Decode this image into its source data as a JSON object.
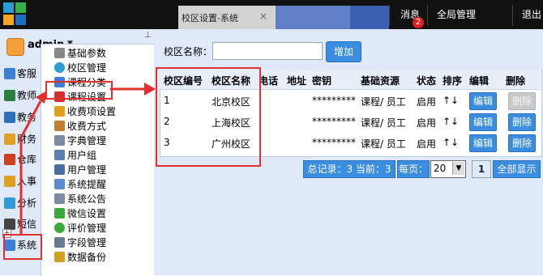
{
  "header": {
    "tab_title": "校区设置-系统",
    "tab_close": "×",
    "nav_message": "消息",
    "message_badge": "2",
    "nav_global": "全局管理",
    "nav_exit": "退出"
  },
  "user": {
    "name": "admin",
    "caret": "▼",
    "pin": "⊥"
  },
  "modules": [
    {
      "label": "客服",
      "icon": "headset-icon",
      "color": "#3d7fd6"
    },
    {
      "label": "教师",
      "icon": "teacher-icon",
      "color": "#2a7f3c"
    },
    {
      "label": "教务",
      "icon": "book-icon",
      "color": "#2c6fbd"
    },
    {
      "label": "财务",
      "icon": "money-icon",
      "color": "#e0a020"
    },
    {
      "label": "仓库",
      "icon": "house-icon",
      "color": "#d04020"
    },
    {
      "label": "人事",
      "icon": "person-icon",
      "color": "#e0a020"
    },
    {
      "label": "分析",
      "icon": "chart-icon",
      "color": "#2c9bd6"
    },
    {
      "label": "短信",
      "icon": "phone-icon",
      "color": "#444444"
    },
    {
      "label": "系统",
      "icon": "system-icon",
      "color": "#3d7fd6"
    }
  ],
  "tree": [
    {
      "label": "基础参数",
      "icon": "gear-icon",
      "color": "#888888"
    },
    {
      "label": "校区管理",
      "icon": "globe-icon",
      "color": "#2c9bd6"
    },
    {
      "label": "课程分类",
      "icon": "cube-icon",
      "color": "#3d7fd6"
    },
    {
      "label": "课程设置",
      "icon": "cube-icon",
      "color": "#d03030"
    },
    {
      "label": "收费项设置",
      "icon": "coins-icon",
      "color": "#e0a020"
    },
    {
      "label": "收费方式",
      "icon": "wallet-icon",
      "color": "#c08030"
    },
    {
      "label": "字典管理",
      "icon": "doc-icon",
      "color": "#7a8aa0"
    },
    {
      "label": "用户组",
      "icon": "users-icon",
      "color": "#5a7fb0"
    },
    {
      "label": "用户管理",
      "icon": "user-icon",
      "color": "#4a6fa0"
    },
    {
      "label": "系统提醒",
      "icon": "bell-icon",
      "color": "#5a8ad0"
    },
    {
      "label": "系统公告",
      "icon": "notice-icon",
      "color": "#7a8aa0"
    },
    {
      "label": "微信设置",
      "icon": "wechat-icon",
      "color": "#3aaa3a"
    },
    {
      "label": "评价管理",
      "icon": "star-icon",
      "color": "#3aaa3a"
    },
    {
      "label": "字段管理",
      "icon": "field-icon",
      "color": "#6a7a90"
    },
    {
      "label": "数据备份",
      "icon": "db-icon",
      "color": "#d0a020"
    }
  ],
  "tree_expander": "+",
  "search": {
    "label": "校区名称：",
    "value": "",
    "add_button": "增加"
  },
  "table": {
    "headers": [
      "校区编号",
      "校区名称",
      "电话",
      "地址",
      "密钥",
      "基础资源",
      "状态",
      "排序",
      "编辑",
      "删除"
    ],
    "rows": [
      {
        "id": "1",
        "name": "北京校区",
        "phone": "",
        "address": "",
        "key": "*********",
        "resource": "课程/ 员工",
        "status": "启用",
        "sort": "↑↓",
        "edit": "编辑",
        "delete": "删除",
        "delete_disabled": true
      },
      {
        "id": "2",
        "name": "上海校区",
        "phone": "",
        "address": "",
        "key": "*********",
        "resource": "课程/ 员工",
        "status": "启用",
        "sort": "↑↓",
        "edit": "编辑",
        "delete": "删除",
        "delete_disabled": false
      },
      {
        "id": "3",
        "name": "广州校区",
        "phone": "",
        "address": "",
        "key": "*********",
        "resource": "课程/ 员工",
        "status": "启用",
        "sort": "↑↓",
        "edit": "编辑",
        "delete": "删除",
        "delete_disabled": false
      }
    ]
  },
  "pager": {
    "summary": "总记录：3 当前：3",
    "per_page_label": "每页：",
    "per_page_value": "20",
    "current_page": "1",
    "show_all": "全部显示"
  },
  "colors": {
    "accent": "#3b8de0",
    "annotation": "#e03030",
    "panel": "#dfe9f8"
  }
}
